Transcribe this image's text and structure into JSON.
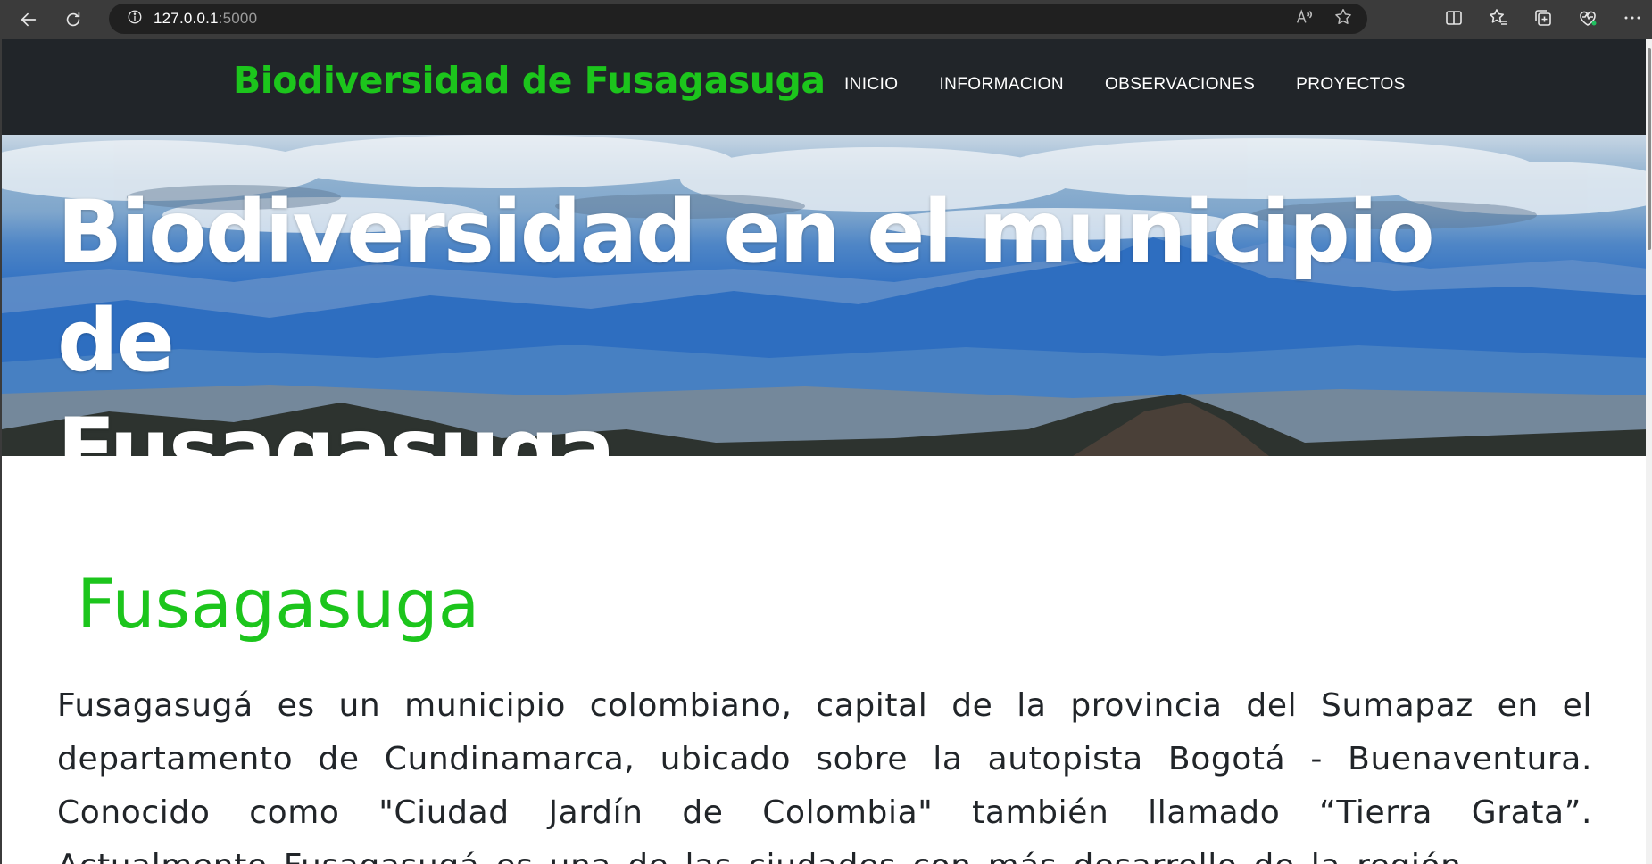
{
  "browser": {
    "url_host": "127.0.0.1",
    "url_port": ":5000",
    "icons": [
      "back-arrow-icon",
      "refresh-icon",
      "site-info-icon",
      "read-aloud-icon",
      "favorite-star-icon",
      "split-screen-icon",
      "favorites-icon",
      "collections-icon",
      "browser-essentials-icon",
      "more-menu-icon"
    ]
  },
  "site": {
    "brand": "Biodiversidad de Fusagasuga",
    "nav": [
      {
        "label": "INICIO"
      },
      {
        "label": "INFORMACION"
      },
      {
        "label": "OBSERVACIONES"
      },
      {
        "label": "PROYECTOS"
      }
    ],
    "brand_color": "#1cc51c",
    "header_bg": "#212529"
  },
  "hero": {
    "title_line1": "Biodiversidad en el municipio de",
    "title_line2": "Fusagasuga"
  },
  "main": {
    "section_title": "Fusagasuga",
    "paragraph": "Fusagasugá es un municipio colombiano, capital de la provincia del Sumapaz en el departamento de Cundinamarca, ubicado sobre la autopista Bogotá - Buenaventura. Conocido como \"Ciudad Jardín de Colombia\" también llamado “Tierra Grata”. Actualmente Fusagasugá es una de las ciudades con más desarrollo de la región"
  }
}
